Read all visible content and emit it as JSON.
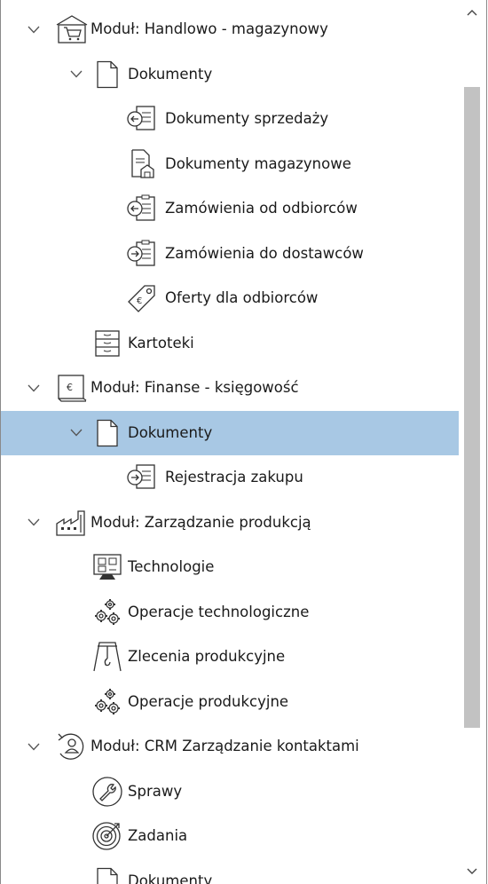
{
  "tree": [
    {
      "level": 0,
      "expanded": true,
      "icon": "module-store-icon",
      "label": "Moduł: Handlowo - magazynowy"
    },
    {
      "level": 1,
      "expanded": true,
      "icon": "document-icon",
      "label": "Dokumenty"
    },
    {
      "level": 2,
      "expanded": null,
      "icon": "sales-document-icon",
      "label": "Dokumenty sprzedaży"
    },
    {
      "level": 2,
      "expanded": null,
      "icon": "warehouse-document-icon",
      "label": "Dokumenty magazynowe"
    },
    {
      "level": 2,
      "expanded": null,
      "icon": "customer-order-icon",
      "label": "Zamówienia od odbiorców"
    },
    {
      "level": 2,
      "expanded": null,
      "icon": "supplier-order-icon",
      "label": "Zamówienia do dostawców"
    },
    {
      "level": 2,
      "expanded": null,
      "icon": "offer-tag-icon",
      "label": "Oferty dla odbiorców"
    },
    {
      "level": 1,
      "expanded": null,
      "icon": "card-index-icon",
      "label": "Kartoteki"
    },
    {
      "level": 0,
      "expanded": true,
      "icon": "module-finance-icon",
      "label": "Moduł: Finanse - księgowość"
    },
    {
      "level": 1,
      "expanded": true,
      "icon": "document-icon",
      "label": "Dokumenty",
      "selected": true
    },
    {
      "level": 2,
      "expanded": null,
      "icon": "purchase-register-icon",
      "label": "Rejestracja zakupu"
    },
    {
      "level": 0,
      "expanded": true,
      "icon": "module-factory-icon",
      "label": "Moduł: Zarządzanie produkcją"
    },
    {
      "level": 1,
      "expanded": null,
      "icon": "technology-icon",
      "label": "Technologie"
    },
    {
      "level": 1,
      "expanded": null,
      "icon": "gears-icon",
      "label": "Operacje technologiczne"
    },
    {
      "level": 1,
      "expanded": null,
      "icon": "crane-icon",
      "label": "Zlecenia produkcyjne"
    },
    {
      "level": 1,
      "expanded": null,
      "icon": "gears-icon",
      "label": "Operacje produkcyjne"
    },
    {
      "level": 0,
      "expanded": true,
      "icon": "module-crm-icon",
      "label": "Moduł: CRM Zarządzanie kontaktami"
    },
    {
      "level": 1,
      "expanded": null,
      "icon": "wrench-icon",
      "label": "Sprawy"
    },
    {
      "level": 1,
      "expanded": null,
      "icon": "target-icon",
      "label": "Zadania"
    },
    {
      "level": 1,
      "expanded": null,
      "icon": "document-icon",
      "label": "Dokumenty"
    }
  ],
  "colors": {
    "selected_row": "#a8c8e4",
    "scroll_thumb": "#c2c2c2",
    "icon_stroke": "#333333"
  }
}
